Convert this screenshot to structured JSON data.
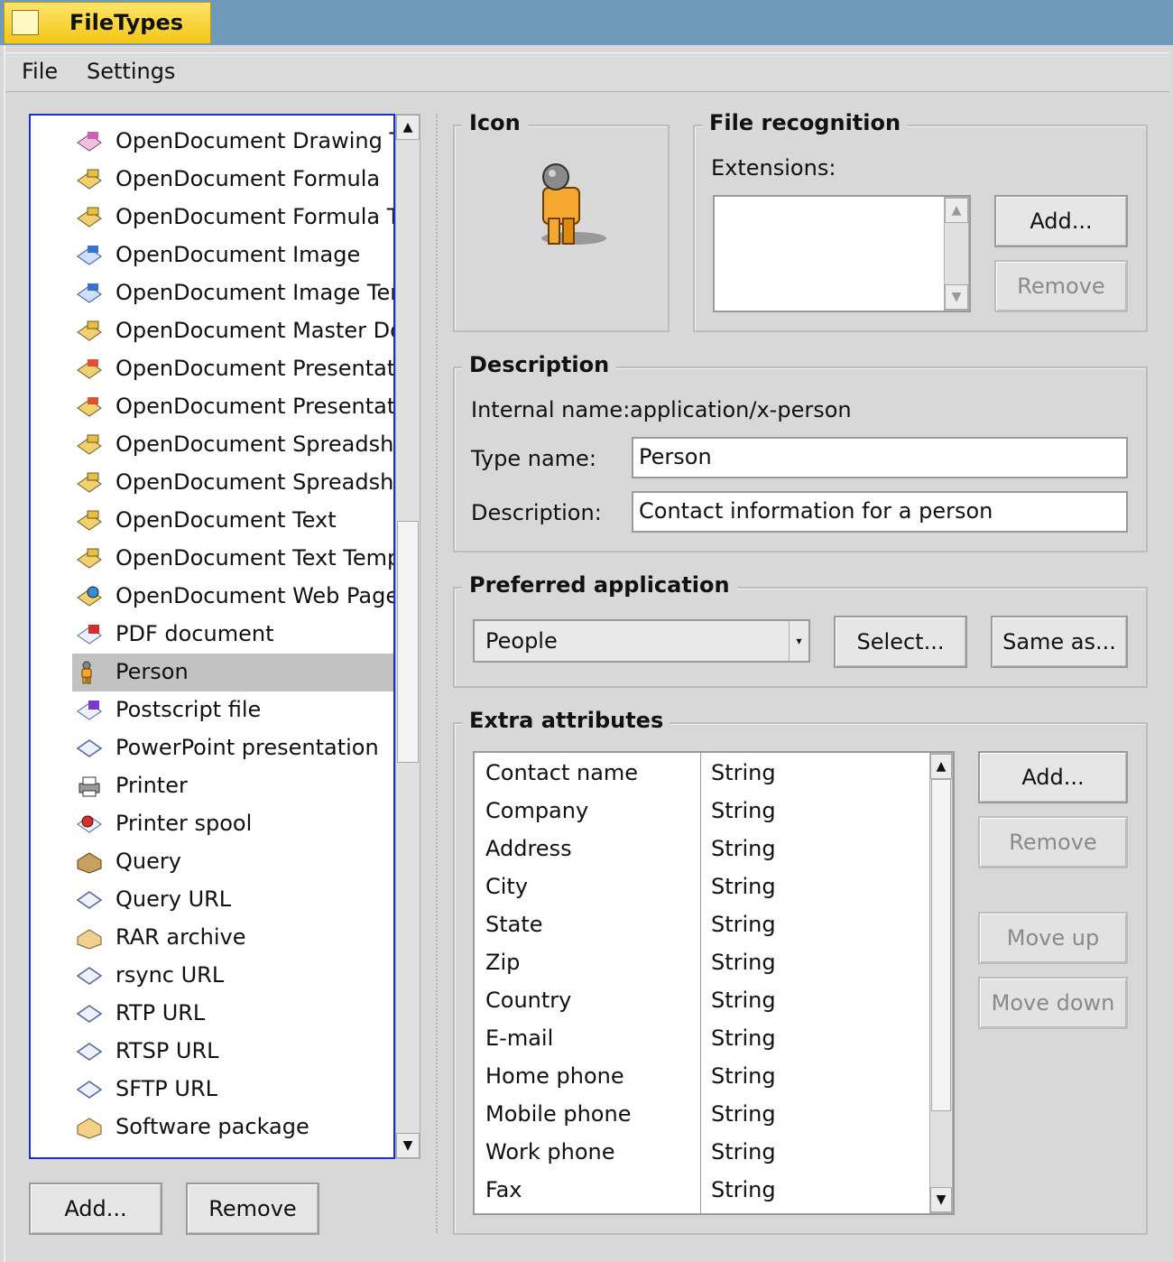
{
  "window": {
    "title": "FileTypes"
  },
  "menu": {
    "items": [
      "File",
      "Settings"
    ]
  },
  "file_types": {
    "items": [
      {
        "label": "OpenDocument Drawing Te",
        "icon": "drawing-doc-icon"
      },
      {
        "label": "OpenDocument Formula",
        "icon": "formula-doc-icon"
      },
      {
        "label": "OpenDocument Formula Te",
        "icon": "formula-doc-icon"
      },
      {
        "label": "OpenDocument Image",
        "icon": "image-doc-icon"
      },
      {
        "label": "OpenDocument Image Tem",
        "icon": "image-doc-icon"
      },
      {
        "label": "OpenDocument Master Doc",
        "icon": "master-doc-icon"
      },
      {
        "label": "OpenDocument Presentatio",
        "icon": "presentation-doc-icon"
      },
      {
        "label": "OpenDocument Presentatio",
        "icon": "presentation-doc-icon"
      },
      {
        "label": "OpenDocument Spreadshee",
        "icon": "spreadsheet-doc-icon"
      },
      {
        "label": "OpenDocument Spreadshee",
        "icon": "spreadsheet-doc-icon"
      },
      {
        "label": "OpenDocument Text",
        "icon": "text-doc-icon"
      },
      {
        "label": "OpenDocument Text Templa",
        "icon": "text-doc-icon"
      },
      {
        "label": "OpenDocument Web Page T",
        "icon": "web-doc-icon"
      },
      {
        "label": "PDF document",
        "icon": "pdf-doc-icon"
      },
      {
        "label": "Person",
        "icon": "person-icon",
        "selected": true
      },
      {
        "label": "Postscript file",
        "icon": "postscript-doc-icon"
      },
      {
        "label": "PowerPoint presentation",
        "icon": "generic-file-icon"
      },
      {
        "label": "Printer",
        "icon": "printer-icon"
      },
      {
        "label": "Printer spool",
        "icon": "printer-spool-icon"
      },
      {
        "label": "Query",
        "icon": "query-icon"
      },
      {
        "label": "Query URL",
        "icon": "generic-file-icon"
      },
      {
        "label": "RAR archive",
        "icon": "archive-icon"
      },
      {
        "label": "rsync URL",
        "icon": "generic-file-icon"
      },
      {
        "label": "RTP URL",
        "icon": "generic-file-icon"
      },
      {
        "label": "RTSP URL",
        "icon": "generic-file-icon"
      },
      {
        "label": "SFTP URL",
        "icon": "generic-file-icon"
      },
      {
        "label": "Software package",
        "icon": "package-icon"
      }
    ],
    "add_label": "Add...",
    "remove_label": "Remove"
  },
  "icon_group": {
    "title": "Icon",
    "icon": "person-icon"
  },
  "file_recognition": {
    "title": "File recognition",
    "extensions_label": "Extensions:",
    "add_label": "Add...",
    "remove_label": "Remove"
  },
  "description": {
    "title": "Description",
    "internal_name_label": "Internal name:",
    "internal_name_value": "application/x-person",
    "type_name_label": "Type name:",
    "type_name_value": "Person",
    "description_label": "Description:",
    "description_value": "Contact information for a person"
  },
  "preferred_application": {
    "title": "Preferred application",
    "selected": "People",
    "select_label": "Select...",
    "same_as_label": "Same as..."
  },
  "extra_attributes": {
    "title": "Extra attributes",
    "rows": [
      {
        "name": "Contact name",
        "type": "String"
      },
      {
        "name": "Company",
        "type": "String"
      },
      {
        "name": "Address",
        "type": "String"
      },
      {
        "name": "City",
        "type": "String"
      },
      {
        "name": "State",
        "type": "String"
      },
      {
        "name": "Zip",
        "type": "String"
      },
      {
        "name": "Country",
        "type": "String"
      },
      {
        "name": "E-mail",
        "type": "String"
      },
      {
        "name": "Home phone",
        "type": "String"
      },
      {
        "name": "Mobile phone",
        "type": "String"
      },
      {
        "name": "Work phone",
        "type": "String"
      },
      {
        "name": "Fax",
        "type": "String"
      }
    ],
    "add_label": "Add...",
    "remove_label": "Remove",
    "move_up_label": "Move up",
    "move_down_label": "Move down"
  },
  "colors": {
    "title_tab": "#f3c614",
    "desktop": "#6f9bb8",
    "list_border": "#1a2fcf",
    "selection": "#c2c2c2"
  }
}
